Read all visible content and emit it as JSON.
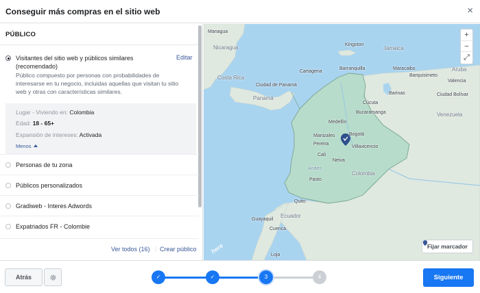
{
  "header": {
    "title": "Conseguir más compras en el sitio web",
    "close": "×"
  },
  "audience": {
    "section_title": "PÚBLICO",
    "selected": {
      "title": "Visitantes del sitio web y públicos similares (recomendado)",
      "edit": "Editar",
      "description": "Público compuesto por personas con probabilidades de interesarse en tu negocio, incluidas aquellas que visitan tu sitio web y otras con características similares."
    },
    "details": {
      "location_label": "Lugar - Viviendo en:",
      "location_value": "Colombia",
      "age_label": "Edad:",
      "age_value": "18 - 65+",
      "expansion_label": "Expansión de intereses:",
      "expansion_value": "Activada",
      "less": "Menos"
    },
    "options": [
      "Personas de tu zona",
      "Públicos personalizados",
      "Gradiweb - Interes Adwords",
      "Expatriados FR - Colombie"
    ],
    "view_all": "Ver todos (16)",
    "separator": "|",
    "create": "Crear público"
  },
  "map": {
    "zoom_in": "+",
    "zoom_out": "−",
    "fit": "⤢",
    "pin_button": "Fijar marcador",
    "attribution": "here",
    "labels": {
      "managua": "Managua",
      "nicaragua": "Nicaragua",
      "kingston": "Kingston",
      "jamaica": "Jamaica",
      "costa_rica": "Costa Rica",
      "panama_city": "Ciudad de Panamá",
      "panama": "Panamá",
      "cartagena": "Cartagena",
      "barranquilla": "Barranquilla",
      "aruba": "Aruba",
      "maracaibo": "Maracaibo",
      "barquisimeto": "Barquisimeto",
      "valencia": "Valencia",
      "barinas": "Barinas",
      "cucuta": "Cúcuta",
      "bucaramanga": "Bucaramanga",
      "medellin": "Medellín",
      "bogota": "Bogotá",
      "villavicencio": "Villavicencio",
      "manizales": "Manizales",
      "pereira": "Pereira",
      "cali": "Cali",
      "neiva": "Neiva",
      "venezuela": "Venezuela",
      "colombia": "Colombia",
      "andes": "Andes",
      "pasto": "Pasto",
      "quito": "Quito",
      "ecuador": "Ecuador",
      "guayaquil": "Guayaquil",
      "cuenca": "Cuenca",
      "loja": "Loja",
      "ciudad_bolivar": "Ciudad Bolívar"
    }
  },
  "footer": {
    "back": "Atrás",
    "next": "Siguiente",
    "steps": [
      "✓",
      "✓",
      "3",
      "4"
    ],
    "current_step": 3
  },
  "colors": {
    "accent": "#1877f2",
    "link": "#385898",
    "ocean": "#a9d4f0",
    "colombia": "#b7dccb",
    "land": "#dfe9e0"
  }
}
